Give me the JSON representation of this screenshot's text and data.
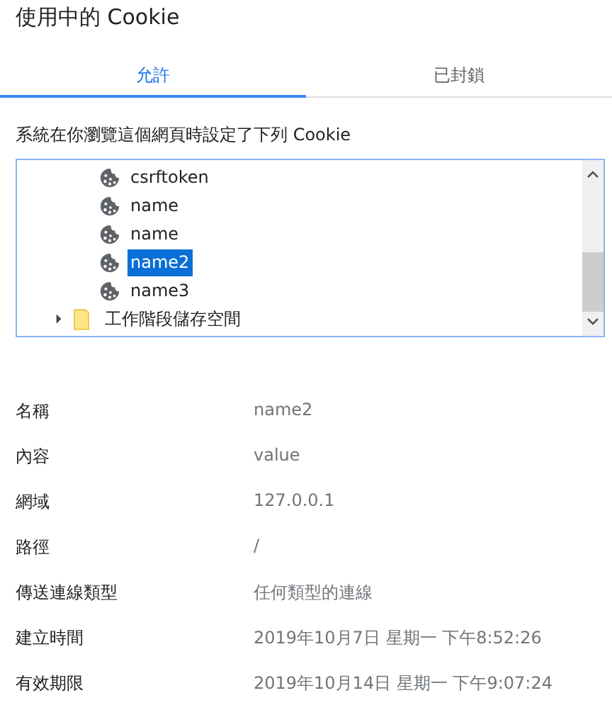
{
  "title": "使用中的 Cookie",
  "tabs": [
    {
      "label": "允許",
      "selected": true
    },
    {
      "label": "已封鎖",
      "selected": false
    }
  ],
  "description": "系統在你瀏覽這個網頁時設定了下列 Cookie",
  "tree": {
    "items": [
      {
        "kind": "cookie",
        "label": "csrftoken",
        "selected": false
      },
      {
        "kind": "cookie",
        "label": "name",
        "selected": false
      },
      {
        "kind": "cookie",
        "label": "name",
        "selected": false
      },
      {
        "kind": "cookie",
        "label": "name2",
        "selected": true
      },
      {
        "kind": "cookie",
        "label": "name3",
        "selected": false
      },
      {
        "kind": "folder",
        "label": "工作階段儲存空間",
        "expanded": false
      }
    ]
  },
  "details": [
    {
      "label": "名稱",
      "value": "name2"
    },
    {
      "label": "內容",
      "value": "value"
    },
    {
      "label": "網域",
      "value": "127.0.0.1"
    },
    {
      "label": "路徑",
      "value": "/"
    },
    {
      "label": "傳送連線類型",
      "value": "任何類型的連線"
    },
    {
      "label": "建立時間",
      "value": "2019年10月7日 星期一 下午8:52:26"
    },
    {
      "label": "有效期限",
      "value": "2019年10月14日 星期一 下午9:07:24"
    }
  ]
}
